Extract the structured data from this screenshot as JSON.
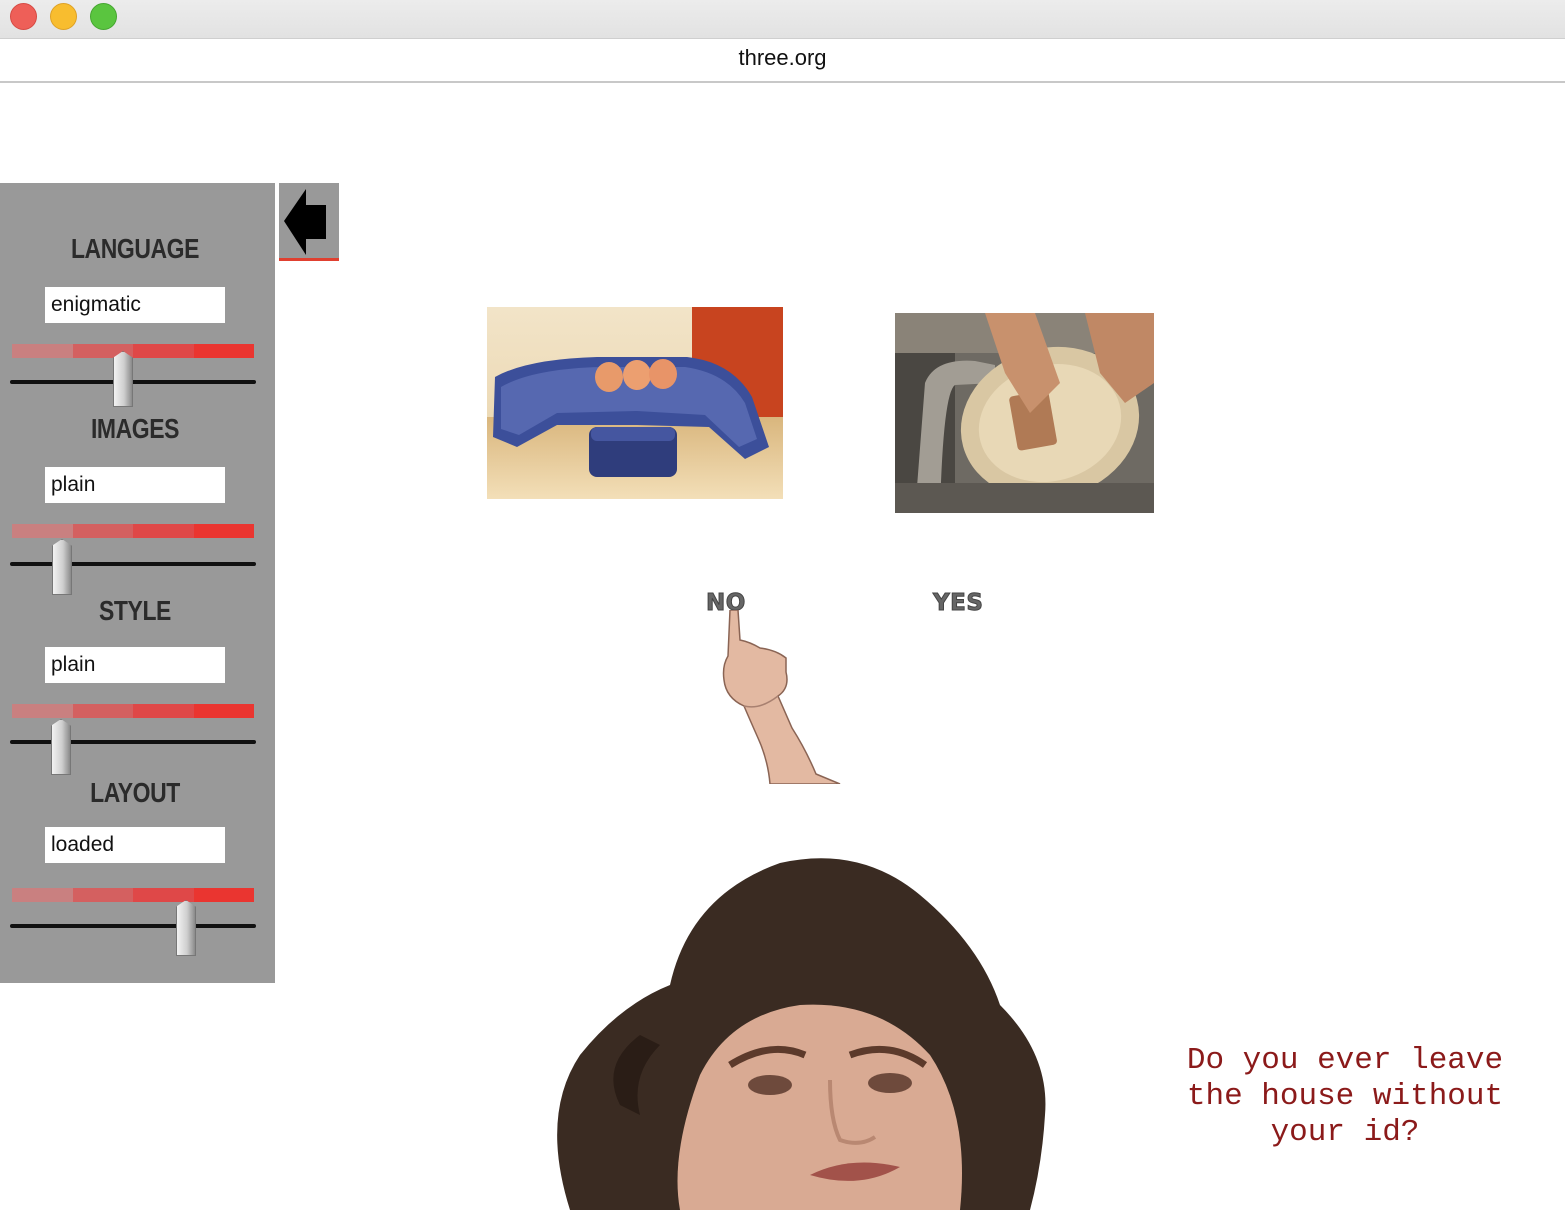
{
  "browser": {
    "url": "three.org"
  },
  "controls": [
    {
      "label": "LANGUAGE",
      "value": "enigmatic",
      "level": 0.45
    },
    {
      "label": "IMAGES",
      "value": "plain",
      "level": 0.2
    },
    {
      "label": "STYLE",
      "value": "plain",
      "level": 0.2
    },
    {
      "label": "LAYOUT",
      "value": "loaded",
      "level": 0.72
    }
  ],
  "nav": {
    "back_icon": "left-arrow-icon"
  },
  "images": {
    "left": "blue-sofa-photo",
    "right": "dishwashing-photo",
    "hand": "pointing-hand",
    "face": "woman-face-looking-up"
  },
  "choices": {
    "no": "NO",
    "yes": "YES"
  },
  "question": "Do you ever leave the house without your id?",
  "colors": {
    "panel": "#999999",
    "question": "#8b1a1a",
    "scale_accent": "#ea3530"
  }
}
